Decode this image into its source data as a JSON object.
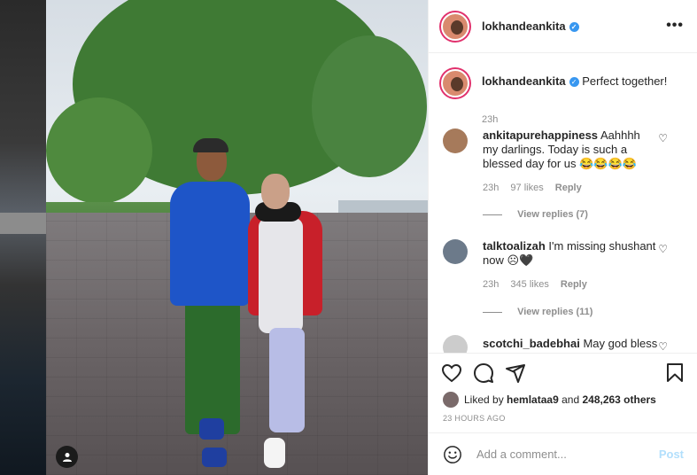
{
  "post": {
    "author": "lokhandeankita",
    "verified_icon": "verified-badge-icon",
    "more_icon": "more-options-icon"
  },
  "caption": {
    "username": "lokhandeankita",
    "text": "Perfect together!",
    "time": "23h"
  },
  "comments": [
    {
      "username": "ankitapurehappiness",
      "text": "Aahhhh my darlings. Today is such a blessed day for us 😂😂😂😂",
      "time": "23h",
      "likes": "97 likes",
      "reply": "Reply",
      "view_replies": "View replies (7)"
    },
    {
      "username": "talktoalizah",
      "text": "I'm missing shushant now ☹🖤",
      "time": "23h",
      "likes": "345 likes",
      "reply": "Reply",
      "view_replies": "View replies (11)"
    },
    {
      "username": "scotchi_badebhai",
      "text": "May god bless"
    }
  ],
  "actions": {
    "like_icon": "heart-icon",
    "comment_icon": "comment-icon",
    "share_icon": "share-icon",
    "save_icon": "bookmark-icon"
  },
  "likes": {
    "prefix": "Liked by",
    "user": "hemlataa9",
    "and": "and",
    "others": "248,263 others"
  },
  "time_ago": "23 HOURS AGO",
  "add_comment": {
    "placeholder": "Add a comment...",
    "post_label": "Post"
  },
  "colors": {
    "accent": "#3897f0",
    "text": "#262626",
    "muted": "#8e8e8e",
    "post_disabled": "#b2dffc"
  }
}
